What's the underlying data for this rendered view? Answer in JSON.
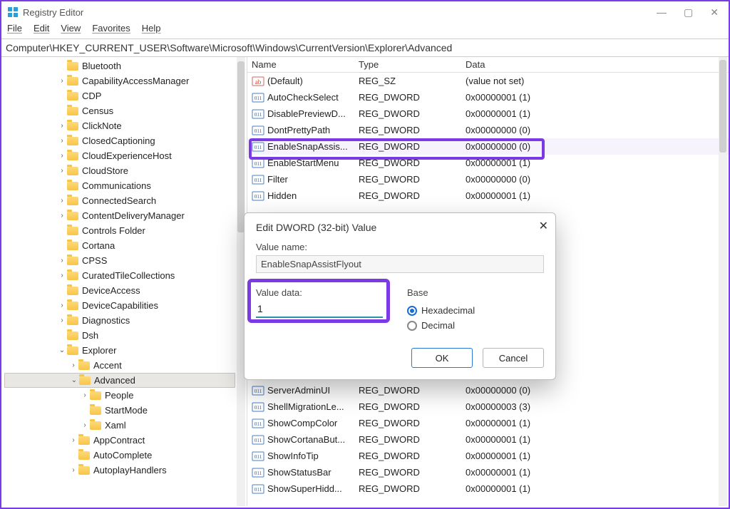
{
  "window": {
    "title": "Registry Editor",
    "minimize_glyph": "—",
    "maximize_glyph": "▢",
    "close_glyph": "✕"
  },
  "menu": {
    "file": "File",
    "edit": "Edit",
    "view": "View",
    "favorites": "Favorites",
    "help": "Help"
  },
  "addressbar": "Computer\\HKEY_CURRENT_USER\\Software\\Microsoft\\Windows\\CurrentVersion\\Explorer\\Advanced",
  "tree": [
    {
      "indent": 4,
      "exp": "",
      "label": "Bluetooth"
    },
    {
      "indent": 4,
      "exp": ">",
      "label": "CapabilityAccessManager"
    },
    {
      "indent": 4,
      "exp": "",
      "label": "CDP"
    },
    {
      "indent": 4,
      "exp": "",
      "label": "Census"
    },
    {
      "indent": 4,
      "exp": ">",
      "label": "ClickNote"
    },
    {
      "indent": 4,
      "exp": ">",
      "label": "ClosedCaptioning"
    },
    {
      "indent": 4,
      "exp": ">",
      "label": "CloudExperienceHost"
    },
    {
      "indent": 4,
      "exp": ">",
      "label": "CloudStore"
    },
    {
      "indent": 4,
      "exp": "",
      "label": "Communications"
    },
    {
      "indent": 4,
      "exp": ">",
      "label": "ConnectedSearch"
    },
    {
      "indent": 4,
      "exp": ">",
      "label": "ContentDeliveryManager"
    },
    {
      "indent": 4,
      "exp": "",
      "label": "Controls Folder"
    },
    {
      "indent": 4,
      "exp": "",
      "label": "Cortana"
    },
    {
      "indent": 4,
      "exp": ">",
      "label": "CPSS"
    },
    {
      "indent": 4,
      "exp": ">",
      "label": "CuratedTileCollections"
    },
    {
      "indent": 4,
      "exp": "",
      "label": "DeviceAccess"
    },
    {
      "indent": 4,
      "exp": ">",
      "label": "DeviceCapabilities"
    },
    {
      "indent": 4,
      "exp": ">",
      "label": "Diagnostics"
    },
    {
      "indent": 4,
      "exp": "",
      "label": "Dsh"
    },
    {
      "indent": 4,
      "exp": "v",
      "label": "Explorer"
    },
    {
      "indent": 5,
      "exp": ">",
      "label": "Accent"
    },
    {
      "indent": 5,
      "exp": "v",
      "label": "Advanced",
      "selected": true
    },
    {
      "indent": 6,
      "exp": ">",
      "label": "People"
    },
    {
      "indent": 6,
      "exp": "",
      "label": "StartMode"
    },
    {
      "indent": 6,
      "exp": ">",
      "label": "Xaml"
    },
    {
      "indent": 5,
      "exp": ">",
      "label": "AppContract"
    },
    {
      "indent": 5,
      "exp": "",
      "label": "AutoComplete"
    },
    {
      "indent": 5,
      "exp": ">",
      "label": "AutoplayHandlers"
    }
  ],
  "columns": {
    "name": "Name",
    "type": "Type",
    "data": "Data"
  },
  "values": [
    {
      "icon": "ab",
      "name": "(Default)",
      "type": "REG_SZ",
      "data": "(value not set)"
    },
    {
      "icon": "dw",
      "name": "AutoCheckSelect",
      "type": "REG_DWORD",
      "data": "0x00000001 (1)"
    },
    {
      "icon": "dw",
      "name": "DisablePreviewD...",
      "type": "REG_DWORD",
      "data": "0x00000001 (1)"
    },
    {
      "icon": "dw",
      "name": "DontPrettyPath",
      "type": "REG_DWORD",
      "data": "0x00000000 (0)"
    },
    {
      "icon": "dw",
      "name": "EnableSnapAssis...",
      "type": "REG_DWORD",
      "data": "0x00000000 (0)",
      "hl": true
    },
    {
      "icon": "dw",
      "name": "EnableStartMenu",
      "type": "REG_DWORD",
      "data": "0x00000001 (1)"
    },
    {
      "icon": "dw",
      "name": "Filter",
      "type": "REG_DWORD",
      "data": "0x00000000 (0)"
    },
    {
      "icon": "dw",
      "name": "Hidden",
      "type": "REG_DWORD",
      "data": "0x00000001 (1)"
    },
    {
      "icon": "dw",
      "name": "ServerAdminUI",
      "type": "REG_DWORD",
      "data": "0x00000000 (0)"
    },
    {
      "icon": "dw",
      "name": "ShellMigrationLe...",
      "type": "REG_DWORD",
      "data": "0x00000003 (3)"
    },
    {
      "icon": "dw",
      "name": "ShowCompColor",
      "type": "REG_DWORD",
      "data": "0x00000001 (1)"
    },
    {
      "icon": "dw",
      "name": "ShowCortanaBut...",
      "type": "REG_DWORD",
      "data": "0x00000001 (1)"
    },
    {
      "icon": "dw",
      "name": "ShowInfoTip",
      "type": "REG_DWORD",
      "data": "0x00000001 (1)"
    },
    {
      "icon": "dw",
      "name": "ShowStatusBar",
      "type": "REG_DWORD",
      "data": "0x00000001 (1)"
    },
    {
      "icon": "dw",
      "name": "ShowSuperHidd...",
      "type": "REG_DWORD",
      "data": "0x00000001 (1)"
    }
  ],
  "dialog": {
    "title": "Edit DWORD (32-bit) Value",
    "value_name_label": "Value name:",
    "value_name": "EnableSnapAssistFlyout",
    "value_data_label": "Value data:",
    "value_data": "1",
    "base_label": "Base",
    "hex_label": "Hexadecimal",
    "dec_label": "Decimal",
    "ok": "OK",
    "cancel": "Cancel",
    "close_glyph": "✕"
  }
}
